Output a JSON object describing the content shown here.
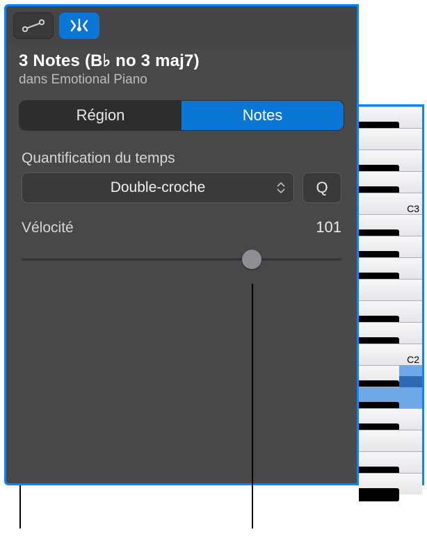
{
  "header": {
    "title_prefix": "3 Notes (B",
    "title_flat": "♭",
    "title_suffix": " no 3 maj7)",
    "subtitle": "dans Emotional Piano"
  },
  "tabs": {
    "region": "Région",
    "notes": "Notes"
  },
  "quantize": {
    "label": "Quantification du temps",
    "value": "Double-croche",
    "button": "Q"
  },
  "velocity": {
    "label": "Vélocité",
    "value": "101",
    "percent": 72
  },
  "piano": {
    "labels": {
      "c3": "C3",
      "c2": "C2"
    }
  }
}
